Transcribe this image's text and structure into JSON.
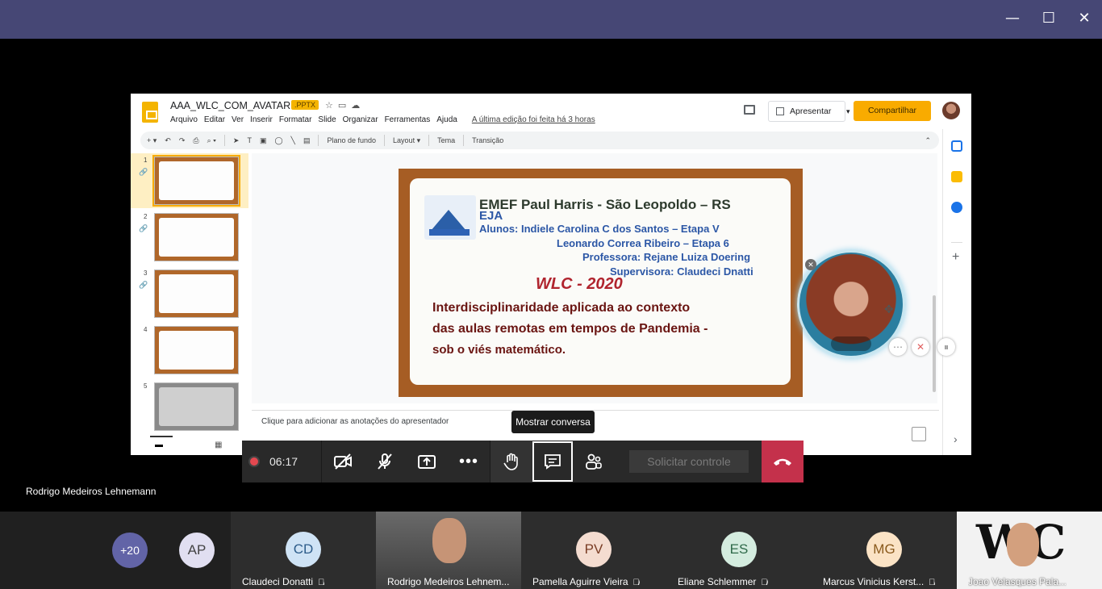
{
  "window": {
    "minimize": "—",
    "maximize": "☐",
    "close": "✕"
  },
  "slides_app": {
    "doc_title": "AAA_WLC_COM_AVATAR",
    "badge": ".PPTX",
    "menu": [
      "Arquivo",
      "Editar",
      "Ver",
      "Inserir",
      "Formatar",
      "Slide",
      "Organizar",
      "Ferramentas",
      "Ajuda"
    ],
    "last_edit": "A última edição foi feita há 3 horas",
    "present_label": "Apresentar",
    "share_label": "Compartilhar",
    "toolbar": [
      "Plano de fundo",
      "Layout ▾",
      "Tema",
      "Transição"
    ],
    "thumbnails": [
      "1",
      "2",
      "3",
      "4",
      "5"
    ],
    "notes_placeholder": "Clique para adicionar as anotações do apresentador"
  },
  "slide": {
    "title": "EMEF Paul Harris - São Leopoldo – RS",
    "eja": "EJA",
    "students_1": "Alunos: Indiele Carolina C dos Santos – Etapa V",
    "students_2": "Leonardo Correa Ribeiro – Etapa 6",
    "teacher": "Professora: Rejane Luiza Doering",
    "supervisor": "Supervisora: Claudeci Dnatti",
    "wlc": "WLC  -  2020",
    "body_1": "Interdisciplinaridade aplicada ao contexto",
    "body_2": "das aulas remotas em tempos de Pandemia -",
    "body_3": "sob o viés matemático."
  },
  "call": {
    "timer": "06:17",
    "tooltip": "Mostrar conversa",
    "request_control": "Solicitar controle",
    "active_speaker": "Rodrigo Medeiros Lehnemann"
  },
  "participants": {
    "overflow": "+20",
    "ap_initials": "AP",
    "list": [
      {
        "initials": "CD",
        "name": "Claudeci Donatti"
      },
      {
        "initials": "",
        "name": "Rodrigo Medeiros Lehnem..."
      },
      {
        "initials": "PV",
        "name": "Pamella Aguirre Vieira"
      },
      {
        "initials": "ES",
        "name": "Eliane Schlemmer"
      },
      {
        "initials": "MG",
        "name": "Marcus Vinicius Kerst..."
      },
      {
        "initials": "",
        "name": "Joao Velasques Pala..."
      }
    ]
  },
  "colors": {
    "teams_purple": "#464775",
    "hangup": "#c4314b",
    "share_yellow": "#f9ab00"
  }
}
